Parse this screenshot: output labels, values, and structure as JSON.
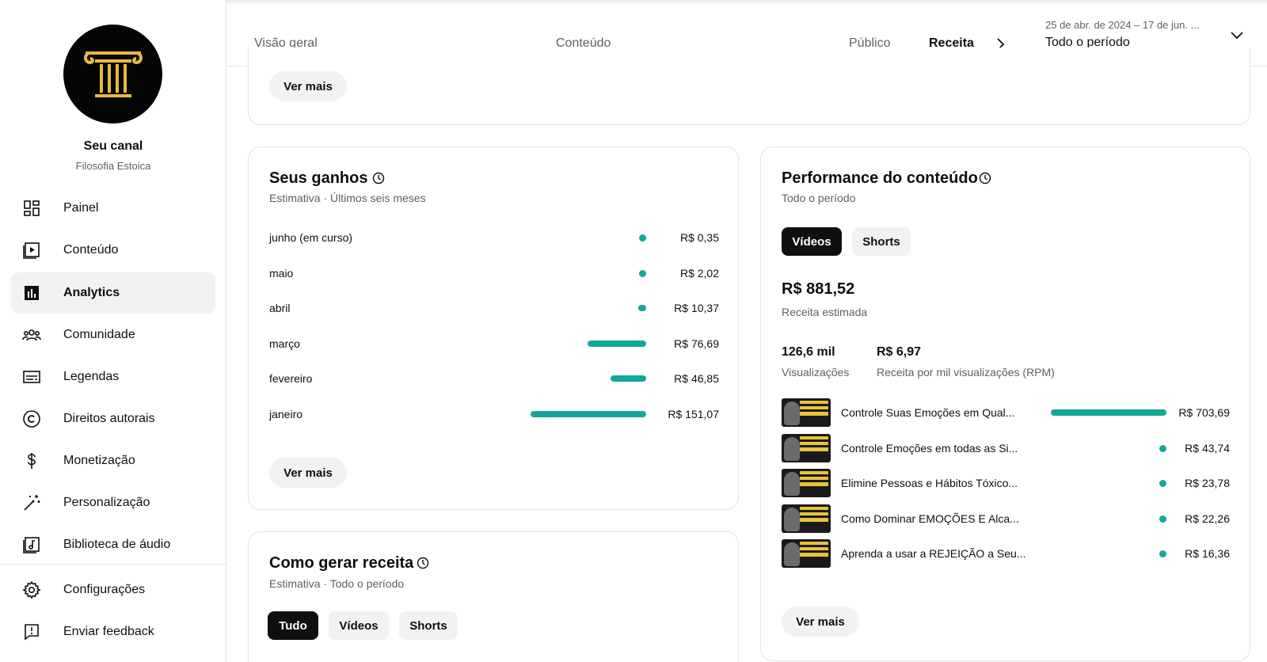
{
  "sidebar": {
    "channel_label": "Seu canal",
    "channel_name": "Filosofia Estoica",
    "items": [
      {
        "label": "Painel",
        "icon": "dashboard-icon"
      },
      {
        "label": "Conteúdo",
        "icon": "content-icon"
      },
      {
        "label": "Analytics",
        "icon": "analytics-icon",
        "active": true
      },
      {
        "label": "Comunidade",
        "icon": "community-icon"
      },
      {
        "label": "Legendas",
        "icon": "subtitles-icon"
      },
      {
        "label": "Direitos autorais",
        "icon": "copyright-icon"
      },
      {
        "label": "Monetização",
        "icon": "dollar-icon"
      },
      {
        "label": "Personalização",
        "icon": "magic-wand-icon"
      },
      {
        "label": "Biblioteca de áudio",
        "icon": "audio-library-icon"
      }
    ],
    "bottom_items": [
      {
        "label": "Configurações",
        "icon": "gear-icon"
      },
      {
        "label": "Enviar feedback",
        "icon": "feedback-icon"
      }
    ]
  },
  "tabs": {
    "items": [
      "Visão geral",
      "Conteúdo",
      "Público",
      "Receita"
    ],
    "active": "Receita"
  },
  "date_range": {
    "range": "25 de abr. de 2024 – 17 de jun. ...",
    "label": "Todo o período"
  },
  "top_card": {
    "more_label": "Ver mais"
  },
  "earnings": {
    "title": "Seus ganhos",
    "subtitle": "Estimativa · Últimos seis meses",
    "rows": [
      {
        "month": "junho (em curso)",
        "value": "R$ 0,35",
        "amount": 0.35
      },
      {
        "month": "maio",
        "value": "R$ 2,02",
        "amount": 2.02
      },
      {
        "month": "abril",
        "value": "R$ 10,37",
        "amount": 10.37
      },
      {
        "month": "março",
        "value": "R$ 76,69",
        "amount": 76.69
      },
      {
        "month": "fevereiro",
        "value": "R$ 46,85",
        "amount": 46.85
      },
      {
        "month": "janeiro",
        "value": "R$ 151,07",
        "amount": 151.07
      }
    ],
    "more_label": "Ver mais",
    "bar_color": "#14a89a"
  },
  "how_to_earn": {
    "title": "Como gerar receita",
    "subtitle": "Estimativa · Todo o período",
    "chips": [
      "Tudo",
      "Vídeos",
      "Shorts"
    ],
    "active_chip": "Tudo"
  },
  "performance": {
    "title": "Performance do conteúdo",
    "subtitle": "Todo o período",
    "chips": [
      "Vídeos",
      "Shorts"
    ],
    "active_chip": "Vídeos",
    "revenue_value": "R$ 881,52",
    "revenue_label": "Receita estimada",
    "views_value": "126,6 mil",
    "views_label": "Visualizações",
    "rpm_value": "R$ 6,97",
    "rpm_label": "Receita por mil visualizações (RPM)",
    "videos": [
      {
        "title": "Controle Suas Emoções em Qual...",
        "value": "R$ 703,69",
        "amount": 703.69
      },
      {
        "title": "Controle Emoções em todas as Si...",
        "value": "R$ 43,74",
        "amount": 43.74
      },
      {
        "title": "Elimine Pessoas e Hábitos Tóxico...",
        "value": "R$ 23,78",
        "amount": 23.78
      },
      {
        "title": "Como Dominar EMOÇÕES E Alca...",
        "value": "R$ 22,26",
        "amount": 22.26
      },
      {
        "title": "Aprenda a usar a REJEIÇÃO a Seu...",
        "value": "R$ 16,36",
        "amount": 16.36
      }
    ],
    "more_label": "Ver mais"
  }
}
